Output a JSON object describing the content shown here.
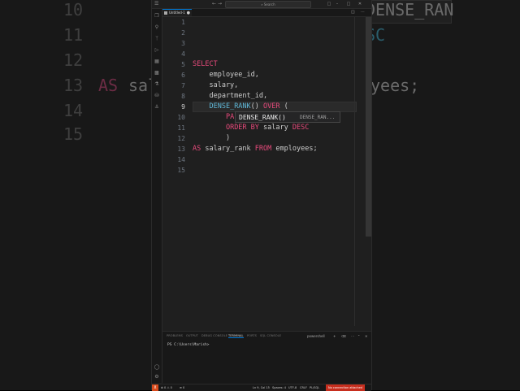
{
  "background": {
    "line_numbers": [
      "10",
      "11",
      "12",
      "13",
      "14",
      "15"
    ],
    "fragments": {
      "top_right": "DENSE_RAN",
      "line11_right": "SC",
      "line13_as": "AS",
      "line13_sal": "sal",
      "line13_right": "yees;"
    }
  },
  "titlebar": {
    "search_label": "Search"
  },
  "tab": {
    "label": "Untitled-1",
    "dirty": "●"
  },
  "editor": {
    "line_numbers": [
      "1",
      "2",
      "3",
      "4",
      "5",
      "6",
      "7",
      "8",
      "9",
      "10",
      "11",
      "12",
      "13",
      "14",
      "15"
    ],
    "active_line": 9,
    "lines": [
      {
        "n": 5,
        "parts": [
          {
            "t": "SELECT",
            "c": "kw"
          }
        ]
      },
      {
        "n": 6,
        "parts": [
          {
            "t": "    employee_id,",
            "c": "pl"
          }
        ]
      },
      {
        "n": 7,
        "parts": [
          {
            "t": "    salary,",
            "c": "pl"
          }
        ]
      },
      {
        "n": 8,
        "parts": [
          {
            "t": "    department_id,",
            "c": "pl"
          }
        ]
      },
      {
        "n": 9,
        "parts": [
          {
            "t": "    ",
            "c": "pl"
          },
          {
            "t": "DENSE_RANK",
            "c": "fn"
          },
          {
            "t": "() ",
            "c": "pl"
          },
          {
            "t": "OVER",
            "c": "kw"
          },
          {
            "t": " (",
            "c": "pl"
          }
        ]
      },
      {
        "n": 10,
        "parts": [
          {
            "t": "        ",
            "c": "pl"
          },
          {
            "t": "PA",
            "c": "kw"
          }
        ]
      },
      {
        "n": 11,
        "parts": [
          {
            "t": "        ",
            "c": "pl"
          },
          {
            "t": "ORDER BY",
            "c": "kw"
          },
          {
            "t": " salary ",
            "c": "pl"
          },
          {
            "t": "DESC",
            "c": "kw"
          }
        ]
      },
      {
        "n": 12,
        "parts": [
          {
            "t": "        )",
            "c": "pl"
          }
        ]
      },
      {
        "n": 13,
        "parts": [
          {
            "t": "AS",
            "c": "kw"
          },
          {
            "t": " salary_rank ",
            "c": "pl"
          },
          {
            "t": "FROM",
            "c": "kw"
          },
          {
            "t": " employees;",
            "c": "pl"
          }
        ]
      }
    ]
  },
  "suggestion": {
    "label": "DENSE_RANK()",
    "detail": "DENSE_RAN..."
  },
  "panel": {
    "tabs": [
      "PROBLEMS",
      "OUTPUT",
      "DEBUG CONSOLE",
      "TERMINAL",
      "PORTS",
      "SQL CONSOLE"
    ],
    "active_tab": "TERMINAL",
    "shell": "powershell",
    "prompt": "PS C:\\Users\\Marish>"
  },
  "statusbar": {
    "problems": "⊗ 0 ⚠ 0",
    "ws": "≡ 0",
    "cursor": "Ln 9, Col 15",
    "spaces": "Spaces: 4",
    "encoding": "UTF-8",
    "eol": "CRLF",
    "language": "PL/SQL",
    "connection": "No connection attached"
  },
  "colors": {
    "keyword": "#e64a7b",
    "function": "#5fb8d8",
    "accent": "#0078d4",
    "error_status": "#c72e1e"
  }
}
